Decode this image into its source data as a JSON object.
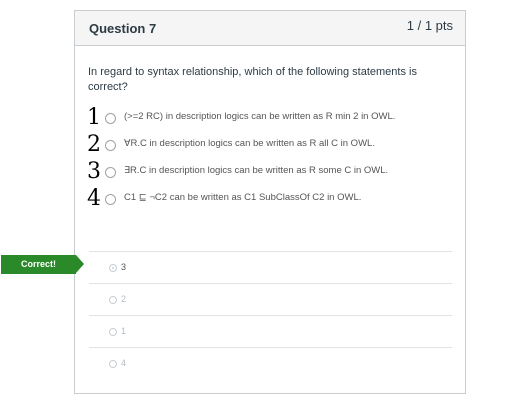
{
  "question": {
    "title": "Question 7",
    "points": "1 / 1 pts",
    "text": "In regard to syntax relationship, which of the following statements is correct?"
  },
  "options": [
    {
      "hand_number": "1",
      "text": "(>=2 RC) in description logics can be written as R min 2 in OWL."
    },
    {
      "hand_number": "2",
      "text": "∀R.C in description logics can be written as R all C in OWL."
    },
    {
      "hand_number": "3",
      "text": "∃R.C in description logics can be written as R some C in OWL."
    },
    {
      "hand_number": "4",
      "text": "C1 ⊑ ¬C2 can be written as C1 SubClassOf C2 in OWL."
    }
  ],
  "result_tag": "Correct!",
  "answers": [
    {
      "label": "3",
      "selected": true
    },
    {
      "label": "2",
      "selected": false
    },
    {
      "label": "1",
      "selected": false
    },
    {
      "label": "4",
      "selected": false
    }
  ],
  "colors": {
    "correct_green": "#2a8a2a",
    "header_bg": "#f5f5f5",
    "border": "#c7cdd1"
  }
}
